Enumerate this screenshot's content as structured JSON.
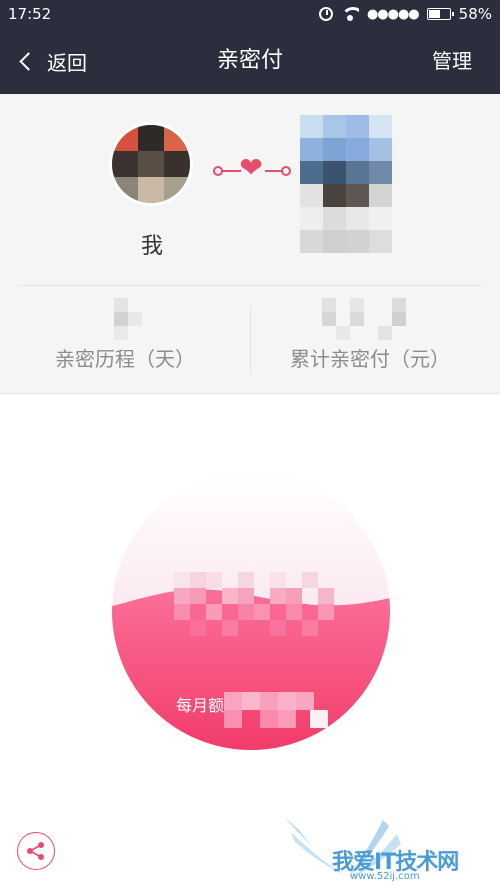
{
  "status_bar": {
    "time": "17:52",
    "signal": "●●●●●",
    "battery_percent": "58%",
    "battery_level": 0.58,
    "icons": [
      "alarm-icon",
      "wifi-icon",
      "signal-dots-icon",
      "battery-icon"
    ]
  },
  "nav": {
    "back_label": "返回",
    "title": "亲密付",
    "manage_label": "管理"
  },
  "header": {
    "me_label": "我",
    "link_icon": "double-heart-icon",
    "stats": [
      {
        "label": "亲密历程（天）"
      },
      {
        "label": "累计亲密付（元）"
      }
    ]
  },
  "circle": {
    "limit_label": "每月额"
  },
  "share_icon": "share-icon",
  "watermark": {
    "text": "我爱IT技术网",
    "sub": "www.52ij.com"
  },
  "colors": {
    "nav_bg": "#2b2f3d",
    "accent": "#e94b6b",
    "circle_pink": "#f7567f",
    "panel_bg": "#f5f5f5"
  }
}
